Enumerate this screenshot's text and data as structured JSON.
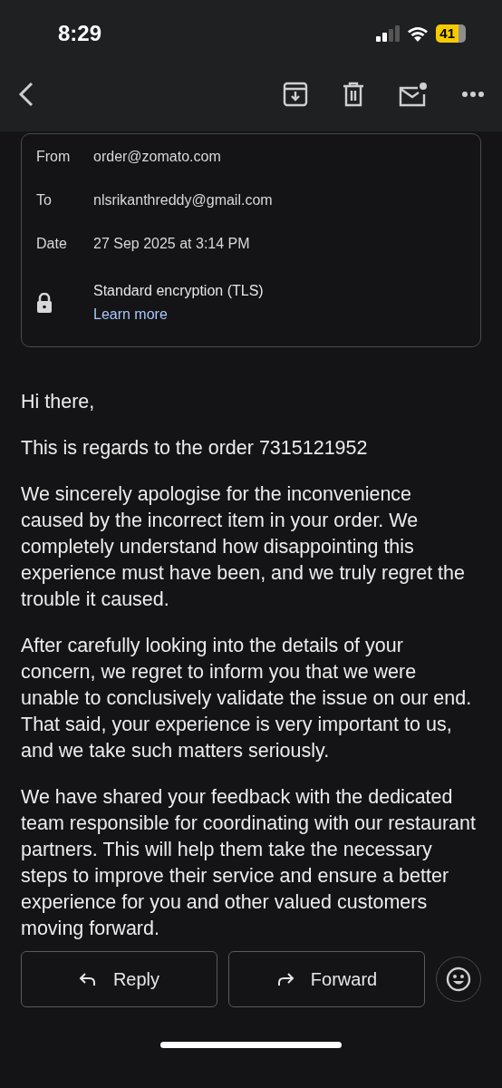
{
  "status_bar": {
    "time": "8:29",
    "battery": "41"
  },
  "details": [
    {
      "label": "From",
      "value": "order@zomato.com"
    },
    {
      "label": "To",
      "value": "nlsrikanthreddy@gmail.com"
    },
    {
      "label": "Date",
      "value": "27 Sep 2025 at 3:14 PM"
    }
  ],
  "encryption": {
    "text": "Standard encryption (TLS)",
    "link": "Learn more"
  },
  "body": [
    "Hi there,",
    "This is regards to the order 7315121952",
    "We sincerely apologise for the inconvenience caused by the incorrect item in your order. We completely understand how disappointing this experience must have been, and we truly regret the trouble it caused.",
    "After carefully looking into the details of your concern, we regret to inform you that we were unable to conclusively validate the issue on our end. That said, your experience is very important to us, and we take such matters seriously.",
    "We have shared your feedback with the dedicated team responsible for coordinating with our restaurant partners. This will help them take the necessary steps to improve their service and ensure a better experience for you and other valued customers moving forward."
  ],
  "actions": [
    {
      "kind": "reply",
      "label": "Reply"
    },
    {
      "kind": "forward",
      "label": "Forward"
    }
  ]
}
